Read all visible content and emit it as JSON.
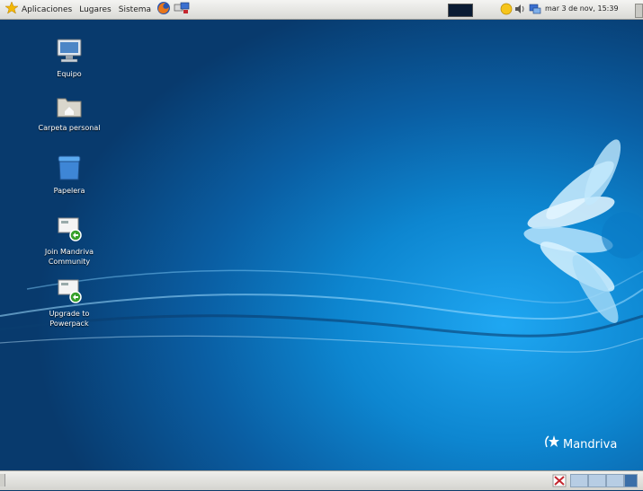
{
  "top_panel": {
    "menus": [
      "Aplicaciones",
      "Lugares",
      "Sistema"
    ],
    "clock": "mar 3 de nov, 15:39"
  },
  "desktop": {
    "icons": [
      {
        "label": "Equipo",
        "icon": "computer-icon"
      },
      {
        "label": "Carpeta personal",
        "icon": "home-folder-icon"
      },
      {
        "label": "Papelera",
        "icon": "trash-icon"
      },
      {
        "label": "Join Mandriva Community",
        "icon": "mandriva-link-icon"
      },
      {
        "label": "Upgrade to Powerpack",
        "icon": "mandriva-link-icon"
      }
    ],
    "brand": "Mandriva"
  },
  "colors": {
    "desktop_bg": "#0d86d0",
    "panel_bg": "#e6e6e3",
    "accent_green": "#37a02b"
  }
}
